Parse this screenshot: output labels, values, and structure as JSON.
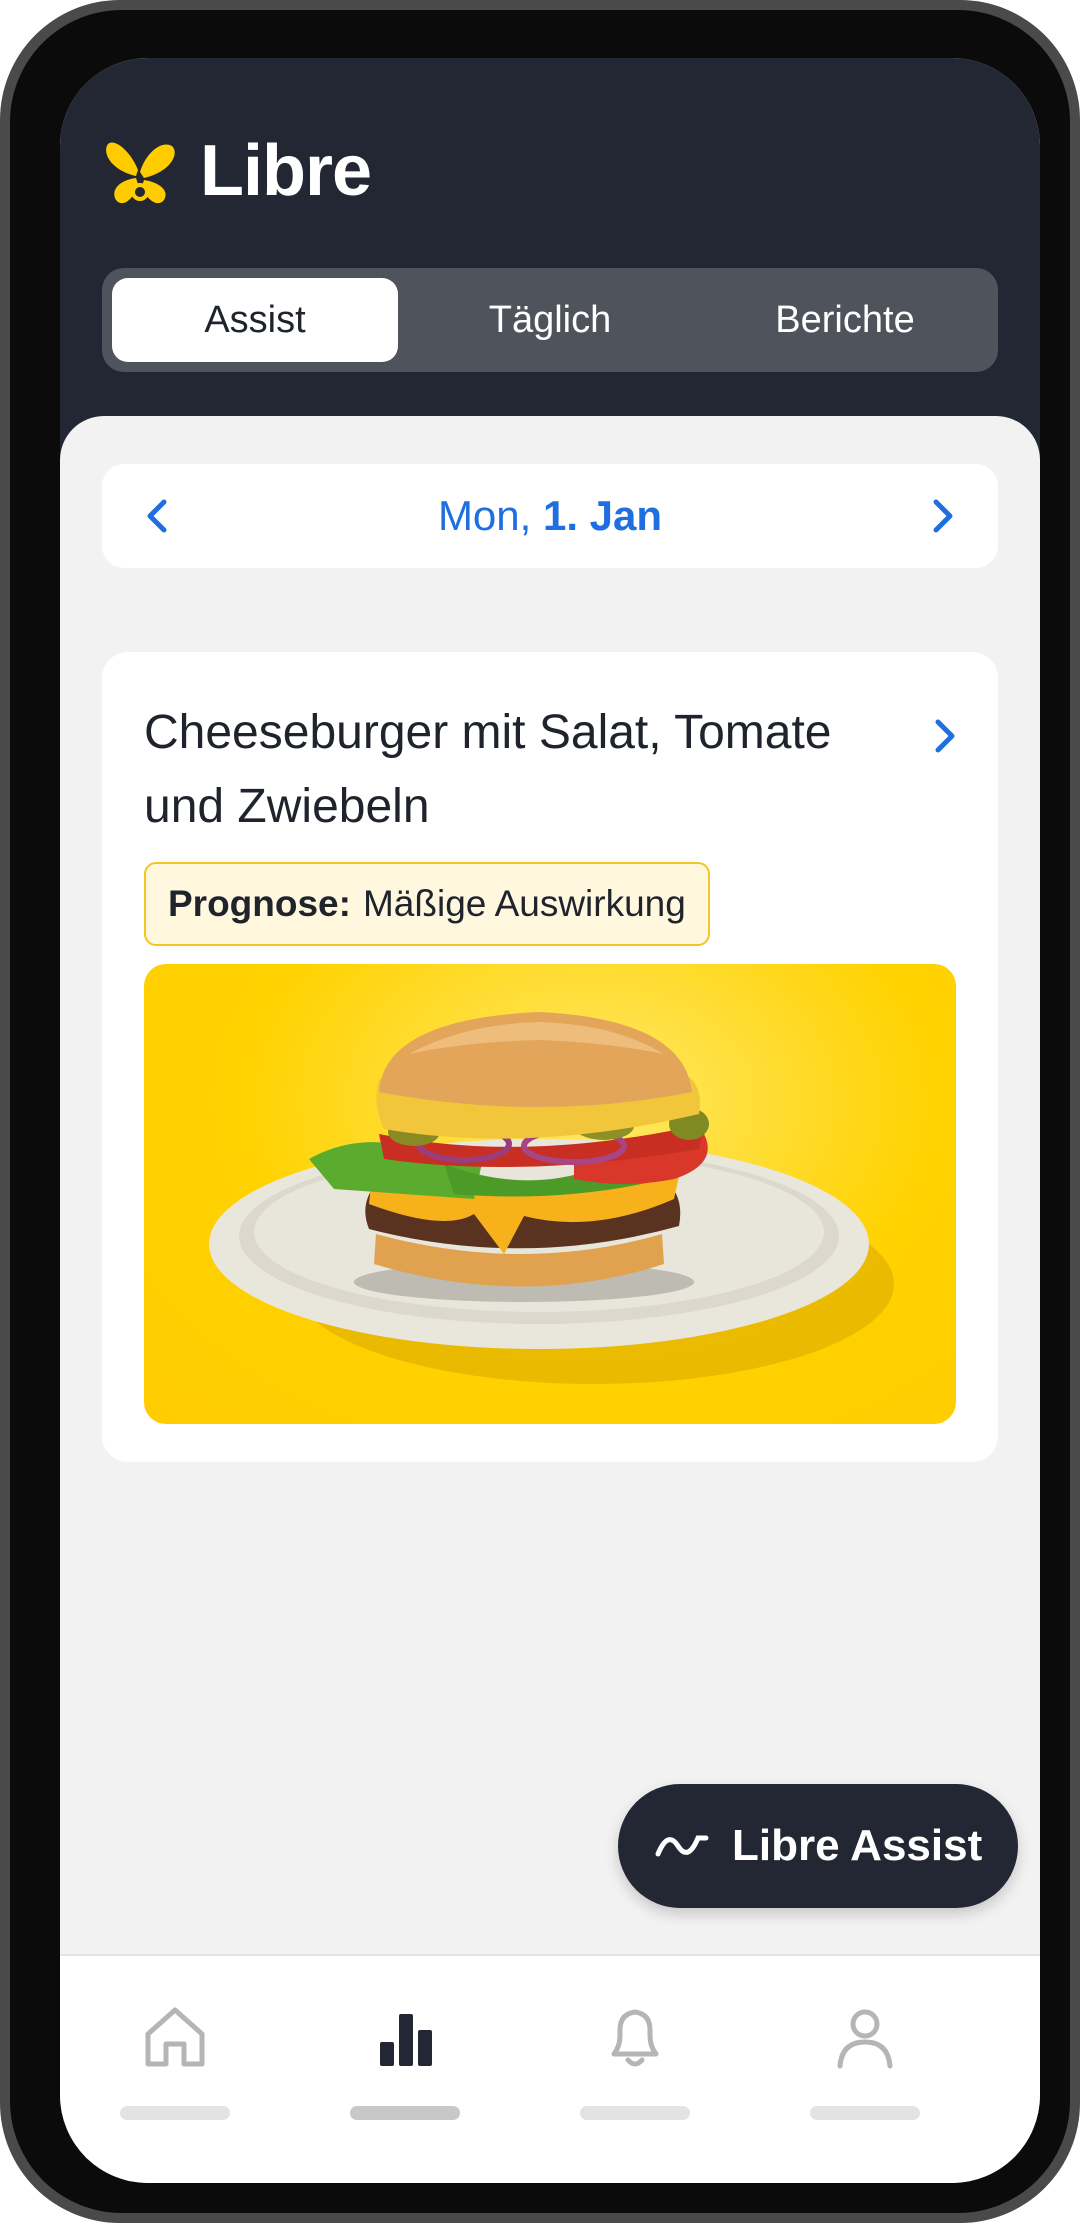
{
  "app": {
    "name": "Libre"
  },
  "tabs": [
    {
      "label": "Assist",
      "active": true
    },
    {
      "label": "Täglich",
      "active": false
    },
    {
      "label": "Berichte",
      "active": false
    }
  ],
  "date_nav": {
    "weekday": "Mon,",
    "date": "1. Jan"
  },
  "meal_card": {
    "title": "Cheeseburger mit Salat, Tomate und Zwiebeln",
    "prognosis_label": "Prognose:",
    "prognosis_value": "Mäßige Auswirkung",
    "image": "cheeseburger-on-plate"
  },
  "fab": {
    "label": "Libre Assist",
    "icon": "wave-icon"
  },
  "bottom_nav": [
    {
      "icon": "home-icon",
      "active": false
    },
    {
      "icon": "bar-chart-icon",
      "active": true
    },
    {
      "icon": "bell-icon",
      "active": false
    },
    {
      "icon": "profile-icon",
      "active": false
    }
  ],
  "colors": {
    "header_bg": "#232733",
    "accent_blue": "#1f6fe0",
    "brand_yellow": "#ffcc00",
    "badge_border": "#f3c623"
  }
}
